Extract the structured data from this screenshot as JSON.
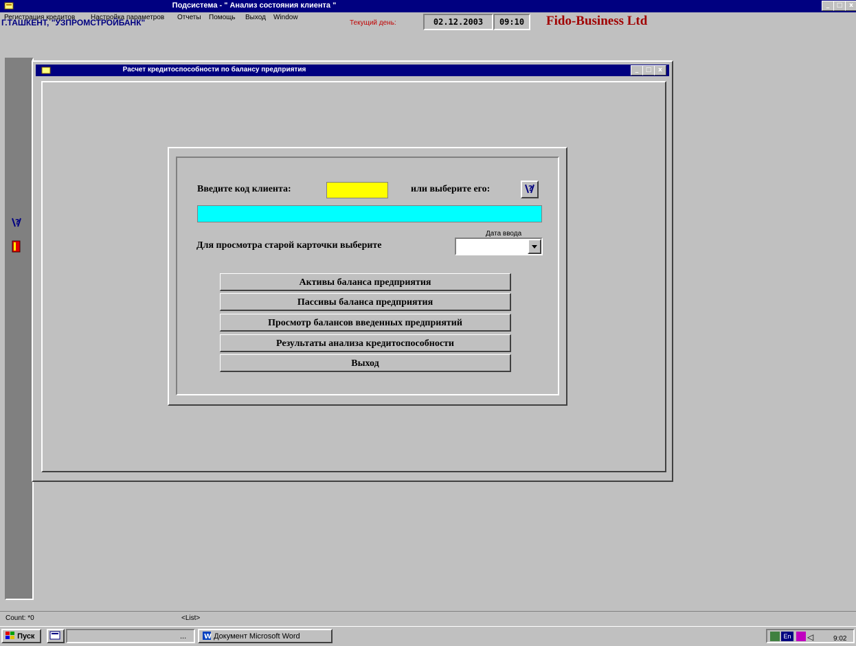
{
  "window": {
    "title": "Подсистема  -   \" Анализ состояния клиента \"",
    "controls": [
      "_",
      "□",
      "x"
    ]
  },
  "menu": [
    {
      "label": "Регистрация кредитов",
      "key": "Р"
    },
    {
      "label": "Настройка параметров",
      "key": "Н"
    },
    {
      "label": "Отчеты",
      "key": "О"
    },
    {
      "label": "Помощь",
      "key": "П"
    },
    {
      "label": "Выход",
      "key": "В"
    },
    {
      "label": "Window",
      "key": "W"
    }
  ],
  "info": {
    "bank": "Г.ТАШКЕНТ, \"УЗПРОМСТРОЙБАНК\"",
    "current_day_label": "Текущий день:",
    "date": "02.12.2003",
    "time": "09:10",
    "company": "Fido-Business Ltd"
  },
  "child": {
    "title": "Расчет кредитоспособности по балансу предприятия",
    "client_code_label": "Введите код клиента:",
    "client_code_value": "",
    "or_select_label": "или выберите его:",
    "client_name": "",
    "date_entry_label": "Дата ввода",
    "old_card_label": "Для просмотра старой карточки выберите",
    "date_combo_value": "",
    "buttons": [
      "Активы баланса предприятия",
      "Пассивы баланса предприятия",
      "Просмотр балансов введенных предприятий",
      "Результаты анализа кредитоспособности",
      "Выход"
    ]
  },
  "status": {
    "count": "Count: *0",
    "list": "<List>"
  },
  "taskbar": {
    "start": "Пуск",
    "ellipsis": "...",
    "word_doc": "Документ Microsoft Word",
    "lang": "En",
    "clock": "9:02"
  },
  "colors": {
    "titlebar": "#000080",
    "input_yellow": "#ffff00",
    "name_cyan": "#00ffff",
    "company_red": "#a00000"
  }
}
